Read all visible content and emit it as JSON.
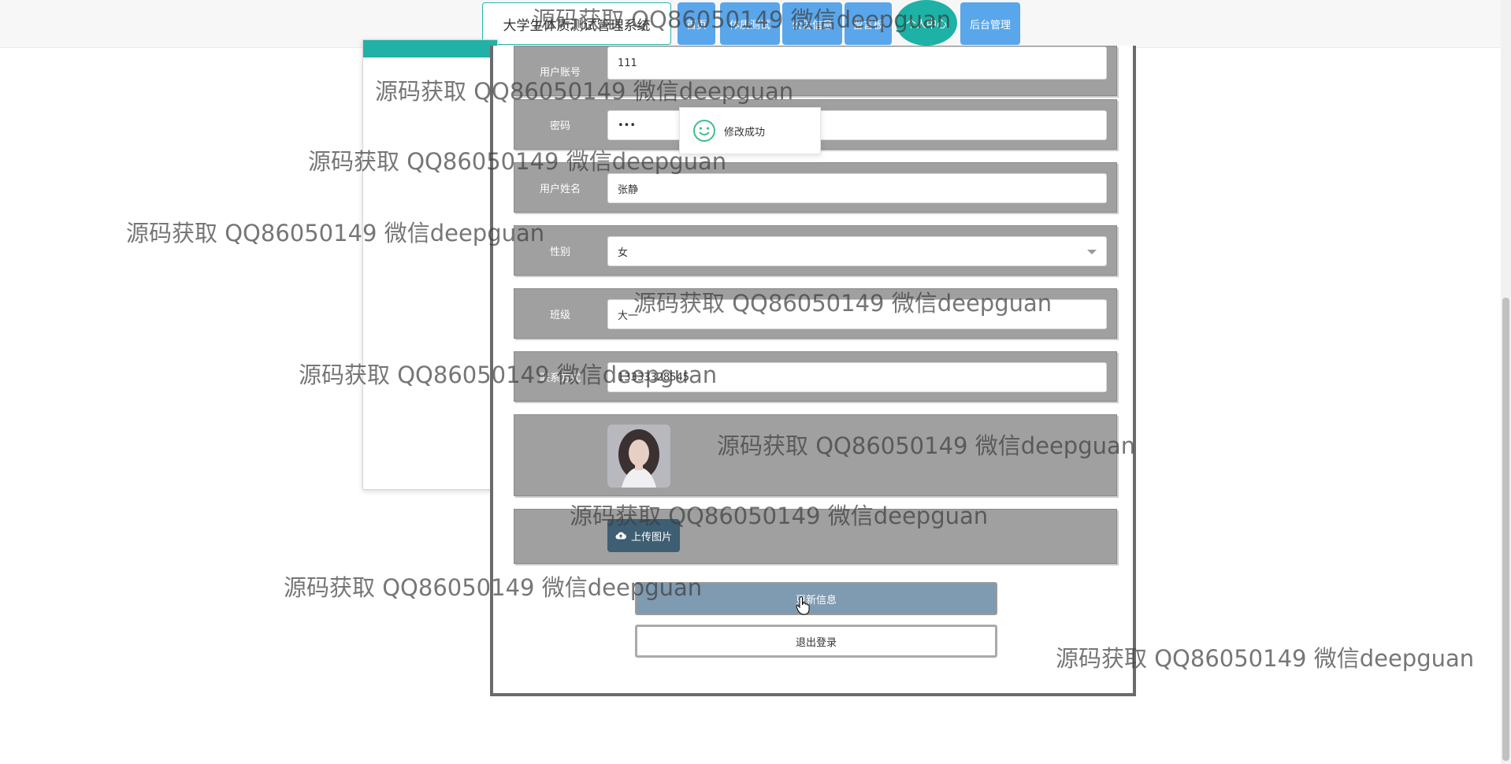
{
  "nav": {
    "site_title": "大学生体质测试管理系统",
    "items": [
      "首页",
      "体质测试",
      "公告信息",
      "留言板",
      "个人中心",
      "后台管理"
    ],
    "active_index": 4
  },
  "form": {
    "fields": [
      {
        "label": "用户账号",
        "value": "111"
      },
      {
        "label": "密码",
        "value": "•••"
      },
      {
        "label": "用户姓名",
        "value": "张静"
      },
      {
        "label": "性别",
        "value": "女"
      },
      {
        "label": "班级",
        "value": "大一"
      },
      {
        "label": "联系方式",
        "value": "13333328545"
      }
    ],
    "upload_label": "上传图片",
    "update_label": "更新信息",
    "logout_label": "退出登录"
  },
  "toast": {
    "message": "修改成功"
  },
  "watermark": "源码获取 QQ86050149 微信deepguan",
  "colors": {
    "accent": "#1db2a5",
    "nav_button": "#5aa6ea",
    "row_bg": "#a0a0a0",
    "upload_button": "#3d5e73",
    "update_button": "#7f9bb1"
  }
}
